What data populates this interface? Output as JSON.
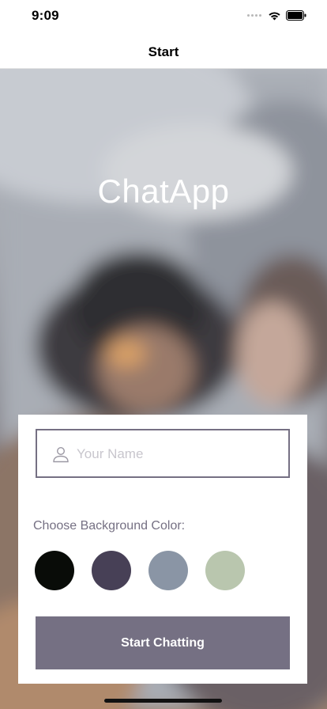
{
  "status_bar": {
    "time": "9:09"
  },
  "nav": {
    "title": "Start"
  },
  "app": {
    "title": "ChatApp"
  },
  "form": {
    "name_placeholder": "Your Name",
    "name_value": "",
    "color_label": "Choose Background Color:",
    "colors": [
      "#090C08",
      "#474056",
      "#8A95A5",
      "#B9C6AE"
    ],
    "start_label": "Start Chatting"
  },
  "icons": {
    "person": "person-icon",
    "wifi": "wifi-icon",
    "battery": "battery-icon",
    "signal": "signal-icon"
  },
  "theme": {
    "accent": "#757083"
  }
}
